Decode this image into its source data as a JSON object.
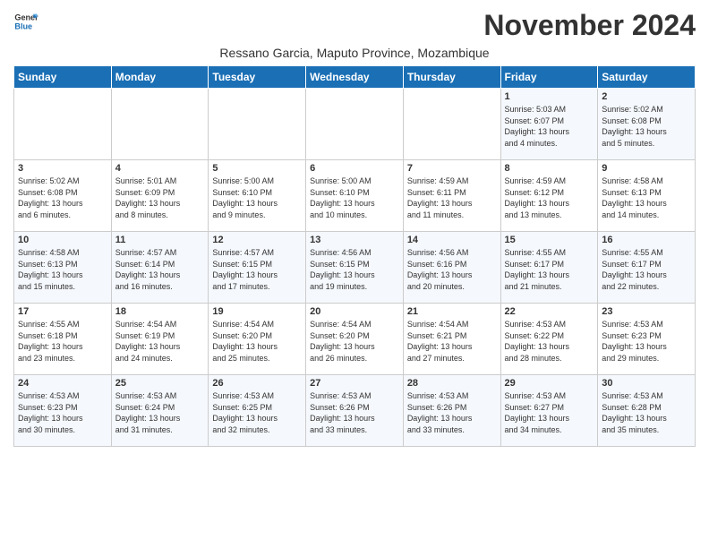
{
  "logo": {
    "line1": "General",
    "line2": "Blue"
  },
  "title": "November 2024",
  "subtitle": "Ressano Garcia, Maputo Province, Mozambique",
  "weekdays": [
    "Sunday",
    "Monday",
    "Tuesday",
    "Wednesday",
    "Thursday",
    "Friday",
    "Saturday"
  ],
  "weeks": [
    [
      {
        "day": "",
        "info": ""
      },
      {
        "day": "",
        "info": ""
      },
      {
        "day": "",
        "info": ""
      },
      {
        "day": "",
        "info": ""
      },
      {
        "day": "",
        "info": ""
      },
      {
        "day": "1",
        "info": "Sunrise: 5:03 AM\nSunset: 6:07 PM\nDaylight: 13 hours\nand 4 minutes."
      },
      {
        "day": "2",
        "info": "Sunrise: 5:02 AM\nSunset: 6:08 PM\nDaylight: 13 hours\nand 5 minutes."
      }
    ],
    [
      {
        "day": "3",
        "info": "Sunrise: 5:02 AM\nSunset: 6:08 PM\nDaylight: 13 hours\nand 6 minutes."
      },
      {
        "day": "4",
        "info": "Sunrise: 5:01 AM\nSunset: 6:09 PM\nDaylight: 13 hours\nand 8 minutes."
      },
      {
        "day": "5",
        "info": "Sunrise: 5:00 AM\nSunset: 6:10 PM\nDaylight: 13 hours\nand 9 minutes."
      },
      {
        "day": "6",
        "info": "Sunrise: 5:00 AM\nSunset: 6:10 PM\nDaylight: 13 hours\nand 10 minutes."
      },
      {
        "day": "7",
        "info": "Sunrise: 4:59 AM\nSunset: 6:11 PM\nDaylight: 13 hours\nand 11 minutes."
      },
      {
        "day": "8",
        "info": "Sunrise: 4:59 AM\nSunset: 6:12 PM\nDaylight: 13 hours\nand 13 minutes."
      },
      {
        "day": "9",
        "info": "Sunrise: 4:58 AM\nSunset: 6:13 PM\nDaylight: 13 hours\nand 14 minutes."
      }
    ],
    [
      {
        "day": "10",
        "info": "Sunrise: 4:58 AM\nSunset: 6:13 PM\nDaylight: 13 hours\nand 15 minutes."
      },
      {
        "day": "11",
        "info": "Sunrise: 4:57 AM\nSunset: 6:14 PM\nDaylight: 13 hours\nand 16 minutes."
      },
      {
        "day": "12",
        "info": "Sunrise: 4:57 AM\nSunset: 6:15 PM\nDaylight: 13 hours\nand 17 minutes."
      },
      {
        "day": "13",
        "info": "Sunrise: 4:56 AM\nSunset: 6:15 PM\nDaylight: 13 hours\nand 19 minutes."
      },
      {
        "day": "14",
        "info": "Sunrise: 4:56 AM\nSunset: 6:16 PM\nDaylight: 13 hours\nand 20 minutes."
      },
      {
        "day": "15",
        "info": "Sunrise: 4:55 AM\nSunset: 6:17 PM\nDaylight: 13 hours\nand 21 minutes."
      },
      {
        "day": "16",
        "info": "Sunrise: 4:55 AM\nSunset: 6:17 PM\nDaylight: 13 hours\nand 22 minutes."
      }
    ],
    [
      {
        "day": "17",
        "info": "Sunrise: 4:55 AM\nSunset: 6:18 PM\nDaylight: 13 hours\nand 23 minutes."
      },
      {
        "day": "18",
        "info": "Sunrise: 4:54 AM\nSunset: 6:19 PM\nDaylight: 13 hours\nand 24 minutes."
      },
      {
        "day": "19",
        "info": "Sunrise: 4:54 AM\nSunset: 6:20 PM\nDaylight: 13 hours\nand 25 minutes."
      },
      {
        "day": "20",
        "info": "Sunrise: 4:54 AM\nSunset: 6:20 PM\nDaylight: 13 hours\nand 26 minutes."
      },
      {
        "day": "21",
        "info": "Sunrise: 4:54 AM\nSunset: 6:21 PM\nDaylight: 13 hours\nand 27 minutes."
      },
      {
        "day": "22",
        "info": "Sunrise: 4:53 AM\nSunset: 6:22 PM\nDaylight: 13 hours\nand 28 minutes."
      },
      {
        "day": "23",
        "info": "Sunrise: 4:53 AM\nSunset: 6:23 PM\nDaylight: 13 hours\nand 29 minutes."
      }
    ],
    [
      {
        "day": "24",
        "info": "Sunrise: 4:53 AM\nSunset: 6:23 PM\nDaylight: 13 hours\nand 30 minutes."
      },
      {
        "day": "25",
        "info": "Sunrise: 4:53 AM\nSunset: 6:24 PM\nDaylight: 13 hours\nand 31 minutes."
      },
      {
        "day": "26",
        "info": "Sunrise: 4:53 AM\nSunset: 6:25 PM\nDaylight: 13 hours\nand 32 minutes."
      },
      {
        "day": "27",
        "info": "Sunrise: 4:53 AM\nSunset: 6:26 PM\nDaylight: 13 hours\nand 33 minutes."
      },
      {
        "day": "28",
        "info": "Sunrise: 4:53 AM\nSunset: 6:26 PM\nDaylight: 13 hours\nand 33 minutes."
      },
      {
        "day": "29",
        "info": "Sunrise: 4:53 AM\nSunset: 6:27 PM\nDaylight: 13 hours\nand 34 minutes."
      },
      {
        "day": "30",
        "info": "Sunrise: 4:53 AM\nSunset: 6:28 PM\nDaylight: 13 hours\nand 35 minutes."
      }
    ]
  ]
}
